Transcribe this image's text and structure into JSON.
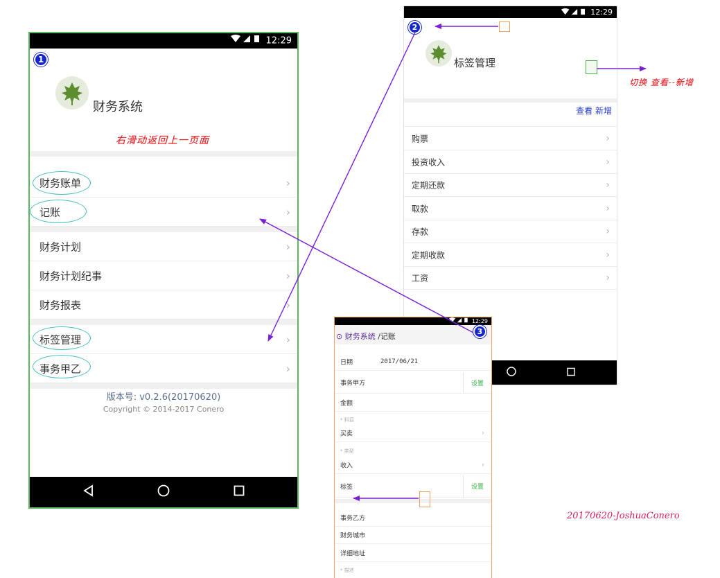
{
  "status_time": "12:29",
  "screen1": {
    "badge": "1",
    "app_title": "财务系统",
    "swipe_note": "右滑动返回上一页面",
    "menu_group1": [
      {
        "label": "财务账单"
      },
      {
        "label": "记账"
      }
    ],
    "menu_group2": [
      {
        "label": "财务计划"
      },
      {
        "label": "财务计划纪事"
      },
      {
        "label": "财务报表"
      }
    ],
    "menu_group3": [
      {
        "label": "标签管理"
      },
      {
        "label": "事务甲乙"
      }
    ],
    "version": "版本号: v0.2.6(20170620)",
    "copyright": "Copyright © 2014-2017 Conero"
  },
  "screen2": {
    "badge": "2",
    "title": "标签管理",
    "view_link": "查看",
    "add_link": "新增",
    "toggle_note": "切换 查看--新增",
    "tags": [
      "购票",
      "投资收入",
      "定期还款",
      "取款",
      "存款",
      "定期收款",
      "工资"
    ]
  },
  "screen3": {
    "badge": "3",
    "breadcrumb_link": "财务系统",
    "breadcrumb_current": "/记账",
    "date_label": "日期",
    "date_value": "2017/06/21",
    "party_a_label": "事务甲方",
    "set_label": "设置",
    "amount_label": "金额",
    "subject_hint": "* 科目",
    "subject_value": "买卖",
    "type_hint": "* 类型",
    "type_value": "收入",
    "tag_label": "标签",
    "party_b_label": "事务乙方",
    "city_label": "财务城市",
    "address_label": "详细地址",
    "desc_hint": "* 描述"
  },
  "signature": "20170620-JoshuaConero",
  "colors": {
    "badge": "#1427c8",
    "oval": "#46bcc0",
    "note_red": "#e02020",
    "arrow_purple": "#7a1fd6",
    "link_blue": "#2a3fd4",
    "set_green": "#39b54a",
    "phone1_border": "#5cb85c",
    "phone3_border": "#f0a060"
  }
}
